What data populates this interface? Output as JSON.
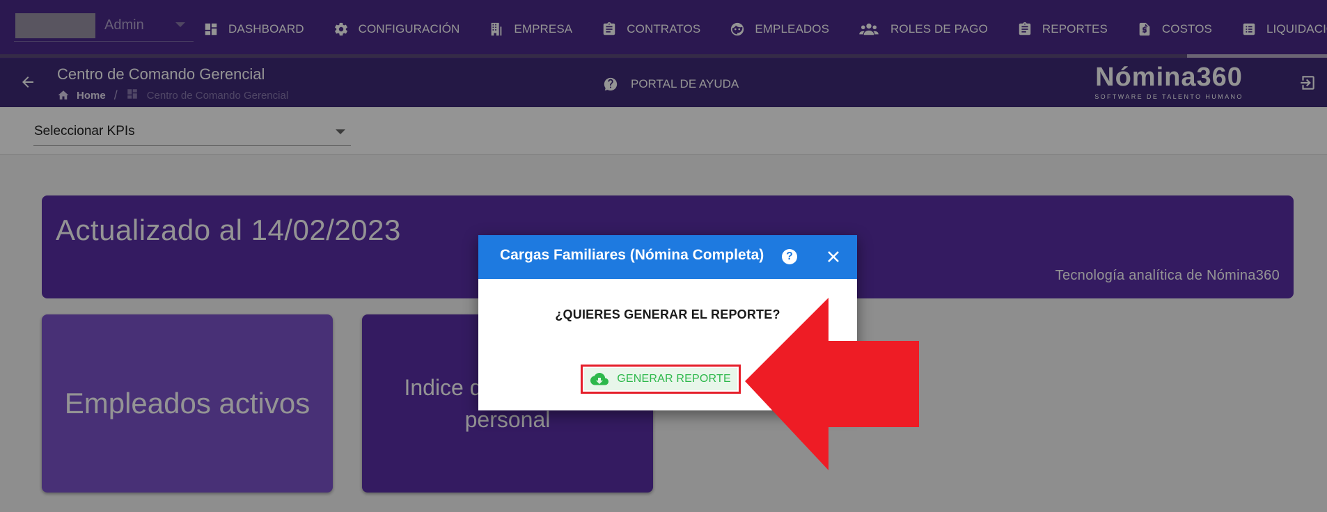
{
  "topnav": {
    "user_role": "Admin",
    "items": [
      {
        "label": "DASHBOARD",
        "icon": "dashboard-icon"
      },
      {
        "label": "CONFIGURACIÓN",
        "icon": "gear-icon"
      },
      {
        "label": "EMPRESA",
        "icon": "building-icon"
      },
      {
        "label": "CONTRATOS",
        "icon": "clipboard-icon"
      },
      {
        "label": "EMPLEADOS",
        "icon": "face-icon"
      },
      {
        "label": "ROLES DE PAGO",
        "icon": "users-icon"
      },
      {
        "label": "REPORTES",
        "icon": "clipboard-icon"
      },
      {
        "label": "COSTOS",
        "icon": "invoice-icon"
      },
      {
        "label": "LIQUIDACIONES",
        "icon": "list-icon"
      }
    ]
  },
  "subheader": {
    "title": "Centro de Comando Gerencial",
    "breadcrumb_home": "Home",
    "breadcrumb_separator": "/",
    "breadcrumb_current": "Centro de Comando Gerencial",
    "help_portal": "PORTAL DE AYUDA",
    "logo_name": "Nómina360",
    "logo_tagline": "SOFTWARE DE TALENTO HUMANO"
  },
  "kpi": {
    "select_label": "Seleccionar KPIs"
  },
  "dashboard": {
    "updated": "Actualizado al 14/02/2023",
    "tech_caption": "Tecnología analítica de Nómina360",
    "cards": [
      "Empleados activos",
      "Indice de rotación de personal"
    ]
  },
  "dialog": {
    "title": "Cargas Familiares (Nómina Completa)",
    "help_symbol": "?",
    "question": "¿QUIERES GENERAR EL REPORTE?",
    "button_label": "GENERAR REPORTE"
  },
  "colors": {
    "nav_bg": "#4b2a8a",
    "subheader_bg": "#3e2a78",
    "banner_bg": "#5a2fa8",
    "card_light": "#7c54cc",
    "dialog_header": "#1e7ae0",
    "button_green": "#2db84b",
    "highlight_red": "#e51e2a"
  }
}
